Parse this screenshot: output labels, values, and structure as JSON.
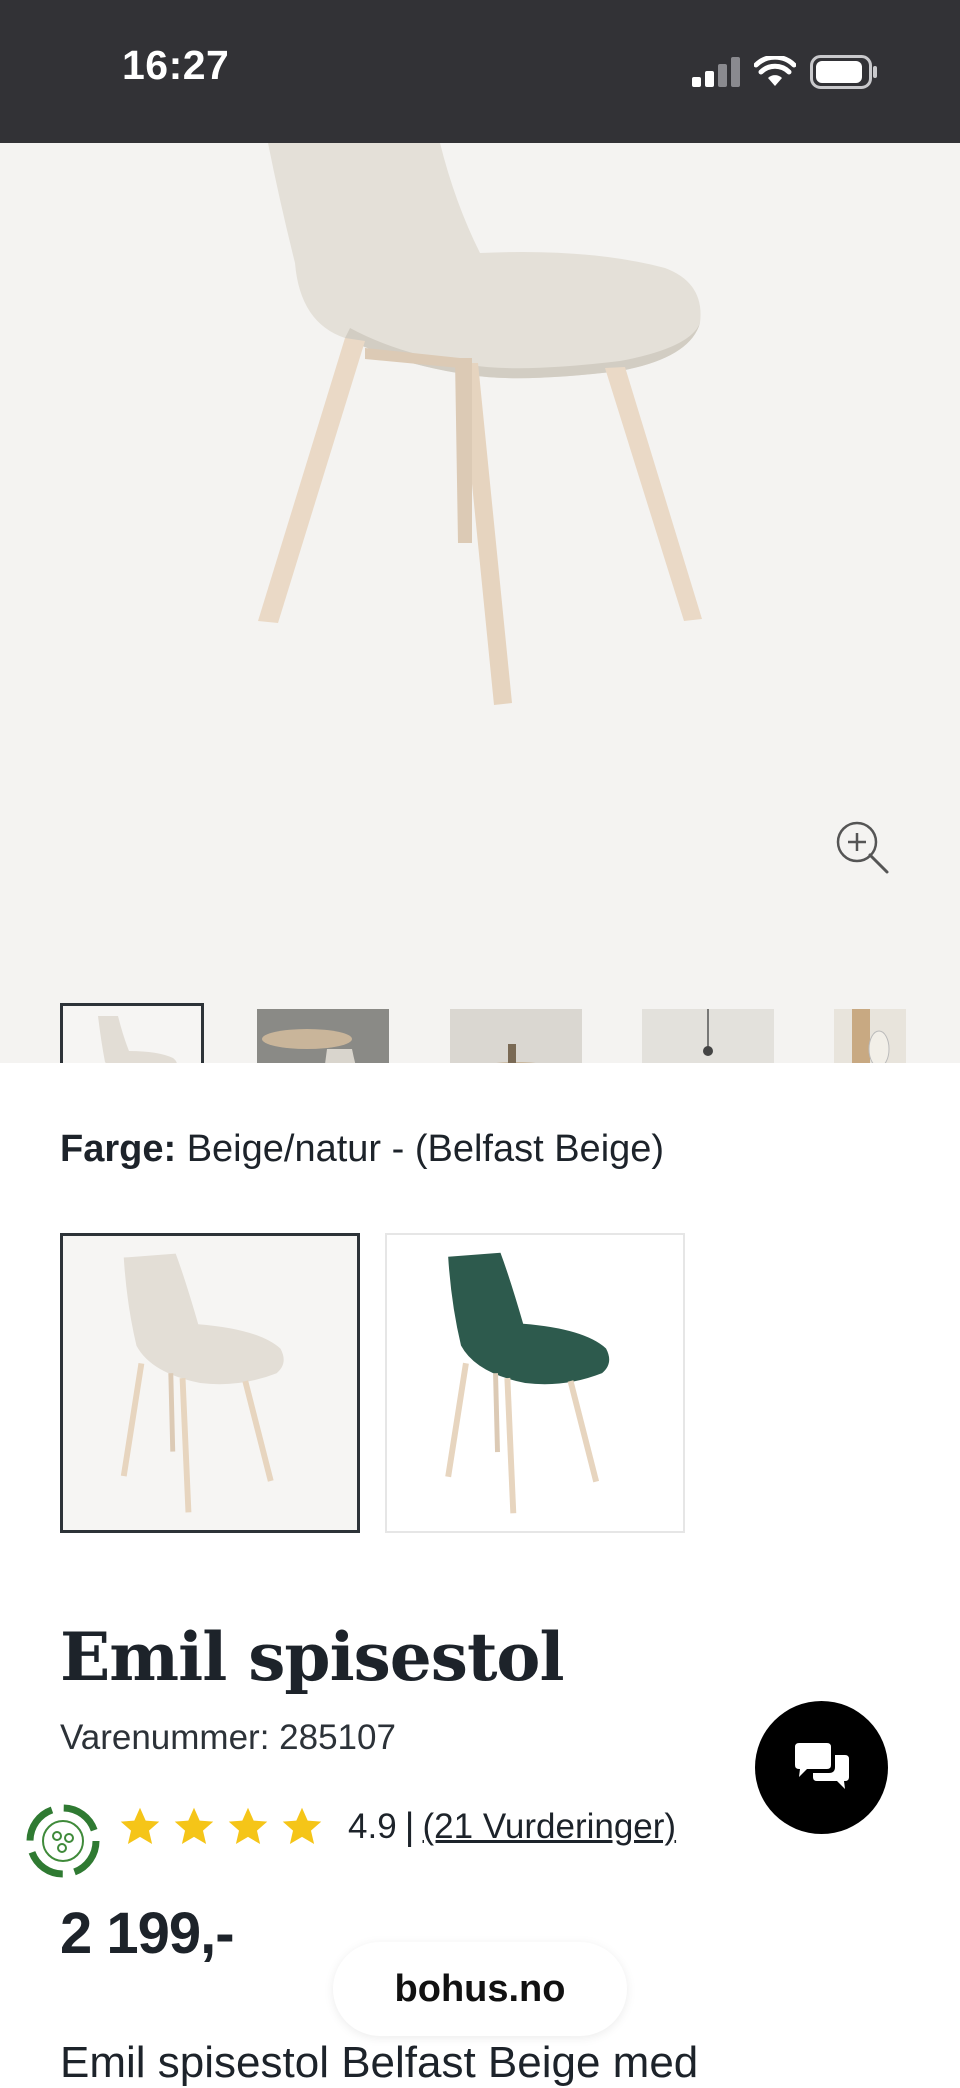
{
  "status_bar": {
    "time": "16:27"
  },
  "gallery": {
    "zoom_icon": "zoom-in-icon",
    "thumbnails": [
      {
        "alt": "chair-front"
      },
      {
        "alt": "chair-room-1"
      },
      {
        "alt": "chair-room-2"
      },
      {
        "alt": "chair-room-3"
      },
      {
        "alt": "chair-room-4"
      }
    ]
  },
  "color": {
    "label": "Farge:",
    "value": "Beige/natur - (Belfast Beige)",
    "swatches": [
      {
        "name": "Beige",
        "color": "#e3ded6"
      },
      {
        "name": "Grønn",
        "color": "#2d5a4d"
      }
    ]
  },
  "product": {
    "title": "Emil spisestol",
    "sku": "Varenummer: 285107",
    "rating_value": "4.9",
    "rating_sep": "|",
    "rating_count": "(21 Vurderinger)",
    "price": "2 199,-",
    "description_start": "Emil spisestol Belfast Beige med"
  },
  "browser": {
    "url": "bohus.no"
  },
  "colors": {
    "status_bg": "#323236",
    "gallery_bg": "#f4f3f1",
    "star": "#f5c518",
    "text": "#1d232a",
    "eco_green": "#2f7a32"
  }
}
